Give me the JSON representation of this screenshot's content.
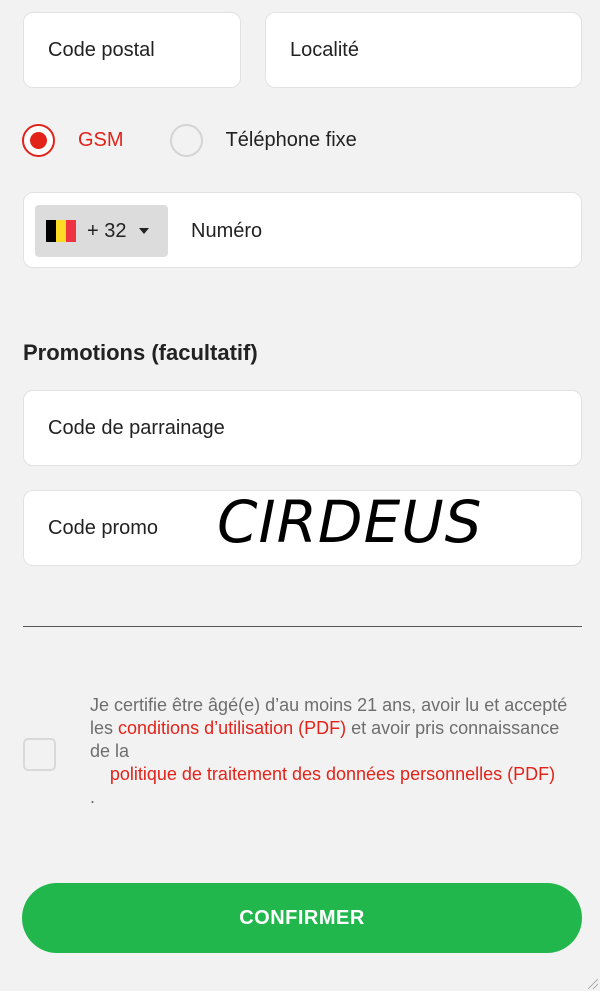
{
  "address": {
    "postal_code_label": "Code postal",
    "locality_label": "Localité"
  },
  "phone_type": {
    "options": [
      {
        "label": "GSM",
        "selected": true
      },
      {
        "label": "Téléphone fixe",
        "selected": false
      }
    ]
  },
  "phone": {
    "country_code": "+ 32",
    "country_flag": "flag-belgium-icon",
    "number_label": "Numéro"
  },
  "promotions": {
    "title": "Promotions (facultatif)",
    "referral_label": "Code de parrainage",
    "promo_label": "Code promo",
    "promo_value": "CIRDEUS"
  },
  "consent": {
    "checked": false,
    "text_part1": "Je certifie être âgé(e) d’au moins 21 ans, avoir lu et accepté les ",
    "terms_link": "conditions d’utilisation (PDF)",
    "text_part2": " et avoir pris connaissance de la",
    "privacy_link": "politique de traitement des données personnelles (PDF)",
    "text_end": "."
  },
  "actions": {
    "confirm_label": "CONFIRMER"
  },
  "colors": {
    "accent_red": "#e2231a",
    "confirm_green": "#22b74d",
    "background": "#f2f2f2",
    "flag_black": "#000000",
    "flag_yellow": "#fdda24",
    "flag_red": "#ef3340"
  }
}
